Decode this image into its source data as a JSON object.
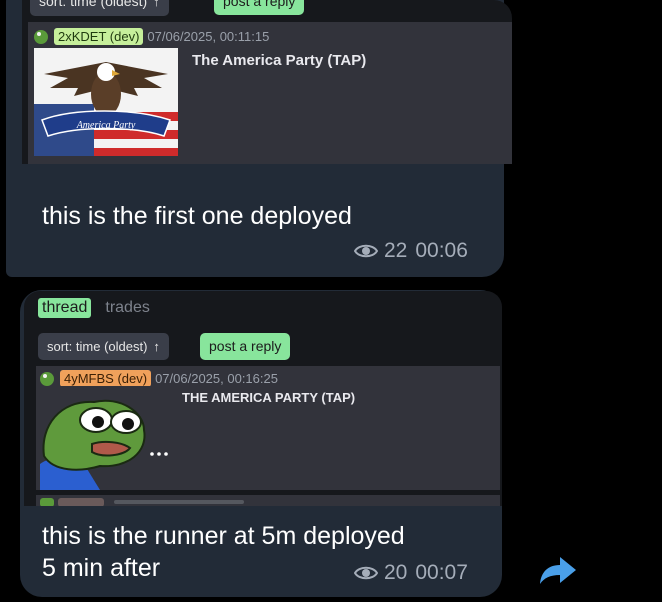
{
  "message1": {
    "sort_label": "sort: time (oldest)",
    "reply_label": "post a reply",
    "card": {
      "badge": "2xKDET (dev)",
      "timestamp": "07/06/2025, 00:11:15",
      "title": "The America Party (TAP)",
      "image_banner_text": "America Party"
    },
    "text": "this is the first one deployed",
    "views": "22",
    "time": "00:06"
  },
  "message2": {
    "tabs": [
      "thread",
      "trades"
    ],
    "sort_label": "sort: time (oldest)",
    "reply_label": "post a reply",
    "card": {
      "badge": "4yMFBS (dev)",
      "timestamp": "07/06/2025, 00:16:25",
      "title": "THE AMERICA PARTY (TAP)"
    },
    "text_line1": "this is the runner at 5m deployed",
    "text_line2": "5 min after",
    "views": "20",
    "time": "00:07"
  },
  "colors": {
    "bubble": "#222b37",
    "reply_button": "#88e59c",
    "dev_badge_green": "#c6ef9b",
    "dev_badge_orange": "#f0a15b",
    "share_icon": "#4a9fe8"
  }
}
